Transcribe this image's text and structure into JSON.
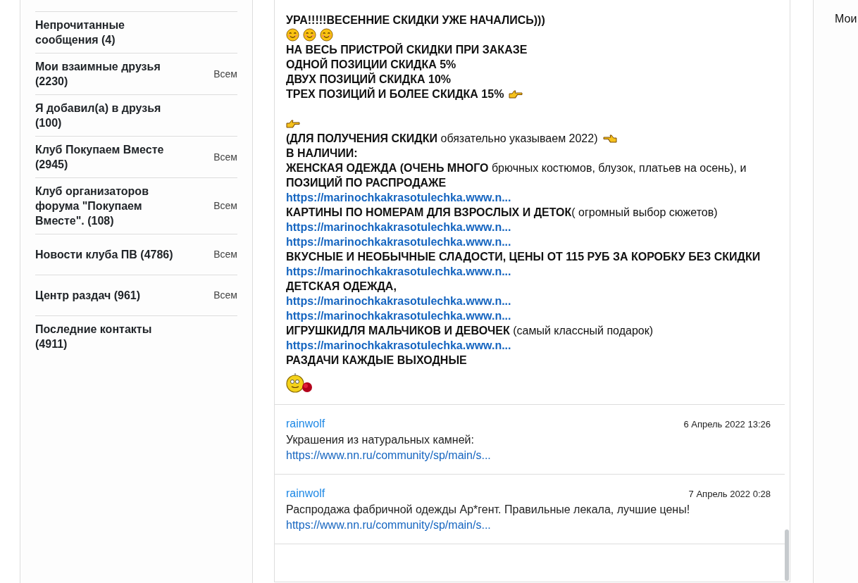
{
  "sidebar": {
    "items": [
      {
        "label": "Непрочитанные сообщения (4)"
      },
      {
        "label": "Мои взаимные друзья (2230)",
        "scope": "Всем"
      },
      {
        "label": "Я добавил(а) в друзья (100)"
      },
      {
        "label": "Клуб Покупаем Вместе (2945)",
        "scope": "Всем"
      },
      {
        "label": "Клуб организаторов форума \"Покупаем Вместе\". (108)",
        "scope": "Всем"
      },
      {
        "label": "Новости клуба ПВ (4786)",
        "scope": "Всем"
      },
      {
        "label": "Центр раздач (961)",
        "scope": "Всем"
      },
      {
        "label": "Последние контакты (4911)"
      }
    ]
  },
  "message": {
    "lines": [
      {
        "kind": "bold",
        "text": "УРА!!!!!ВЕСЕННИЕ СКИДКИ УЖЕ НАЧАЛИСЬ)))"
      },
      {
        "kind": "icons",
        "icons": [
          {
            "kind": "smiley"
          },
          {
            "kind": "smiley"
          },
          {
            "kind": "smiley"
          }
        ]
      },
      {
        "kind": "bold",
        "text": "НА ВЕСЬ ПРИСТРОЙ СКИДКИ ПРИ ЗАКАЗЕ"
      },
      {
        "kind": "bold",
        "text": "ОДНОЙ ПОЗИЦИИ СКИДКА 5%"
      },
      {
        "kind": "bold",
        "text": "ДВУХ ПОЗИЦИЙ СКИДКА 10%"
      },
      {
        "kind": "bold",
        "text": "ТРЕХ ПОЗИЦИЙ И БОЛЕЕ СКИДКА 15%",
        "icons": [
          {
            "kind": "hand-right"
          }
        ]
      },
      {
        "kind": "blank"
      },
      {
        "kind": "icons",
        "icons": [
          {
            "kind": "hand-right"
          }
        ]
      },
      {
        "kind": "mixed",
        "text": "**(ДЛЯ ПОЛУЧЕНИЯ СКИДКИ** обязательно указываем 2022)",
        "icons": [
          {
            "kind": "hand-left"
          }
        ]
      },
      {
        "kind": "bold",
        "text": "В НАЛИЧИИ:"
      },
      {
        "kind": "mixed",
        "text": "**ЖЕНСКАЯ ОДЕЖДА (ОЧЕНЬ МНОГО** брючных костюмов, блузок, платьев на осень), и **ПОЗИЦИЙ ПО РАСПРОДАЖЕ**"
      },
      {
        "kind": "link",
        "text": "https://marinochkakrasotulechka.www.n..."
      },
      {
        "kind": "mixed",
        "text": "**КАРТИНЫ ПО НОМЕРАМ ДЛЯ ВЗРОСЛЫХ И ДЕТОК**( огромный выбор сюжетов)"
      },
      {
        "kind": "link",
        "text": "https://marinochkakrasotulechka.www.n..."
      },
      {
        "kind": "link",
        "text": "https://marinochkakrasotulechka.www.n..."
      },
      {
        "kind": "bold",
        "text": "ВКУСНЫЕ И НЕОБЫЧНЫЕ СЛАДОСТИ, ЦЕНЫ ОТ 115 РУБ ЗА КОРОБКУ БЕЗ СКИДКИ"
      },
      {
        "kind": "link",
        "text": "https://marinochkakrasotulechka.www.n..."
      },
      {
        "kind": "bold",
        "text": "ДЕТСКАЯ ОДЕЖДА,"
      },
      {
        "kind": "link",
        "text": "https://marinochkakrasotulechka.www.n..."
      },
      {
        "kind": "link",
        "text": "https://marinochkakrasotulechka.www.n..."
      },
      {
        "kind": "mixed",
        "text": "**ИГРУШКИДЛЯ МАЛЬЧИКОВ И ДЕВОЧЕК** (самый классный подарок)"
      },
      {
        "kind": "link",
        "text": "https://marinochkakrasotulechka.www.n..."
      },
      {
        "kind": "bold",
        "text": "РАЗДАЧИ КАЖДЫЕ ВЫХОДНЫЕ"
      },
      {
        "kind": "icons",
        "icons": [
          {
            "kind": "smiley-rose"
          }
        ]
      }
    ]
  },
  "comments": [
    {
      "author": "rainwolf",
      "date": "6 Апрель 2022 13:26",
      "text": "Украшения из натуральных камней:",
      "link": "https://www.nn.ru/community/sp/main/s..."
    },
    {
      "author": "rainwolf",
      "date": "7 Апрель 2022 0:28",
      "text": "Распродажа фабричной одежды Ар*гент. Правильные лекала, лучшие цены!",
      "link": "https://www.nn.ru/community/sp/main/s..."
    }
  ],
  "right_panel": {
    "title": "Мои"
  }
}
